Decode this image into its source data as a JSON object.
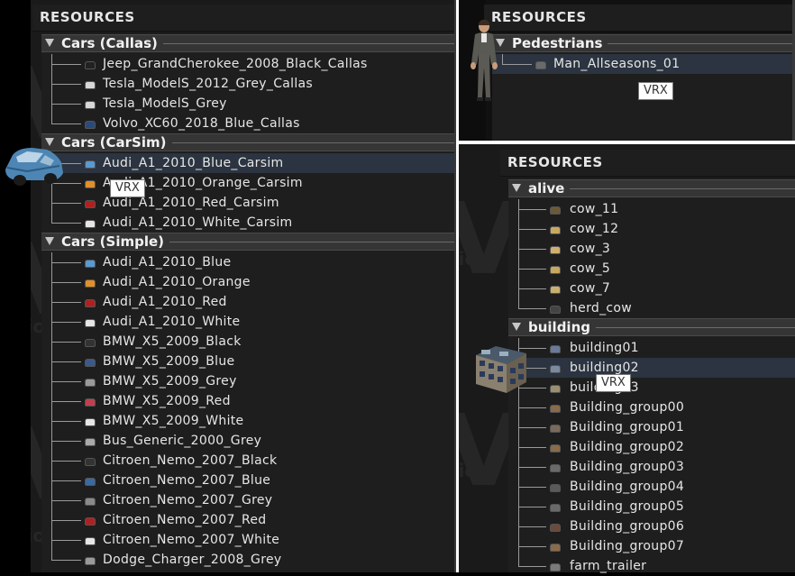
{
  "panel_left": {
    "title": "RESOURCES",
    "categories": [
      {
        "label": "Cars (Callas)",
        "items": [
          {
            "label": "Jeep_GrandCherokee_2008_Black_Callas",
            "color": "#222222"
          },
          {
            "label": "Tesla_ModelS_2012_Grey_Callas",
            "color": "#d8d8d8"
          },
          {
            "label": "Tesla_ModelS_Grey",
            "color": "#d8d8d8"
          },
          {
            "label": "Volvo_XC60_2018_Blue_Callas",
            "color": "#2a4a7a"
          }
        ]
      },
      {
        "label": "Cars (CarSim)",
        "items": [
          {
            "label": "Audi_A1_2010_Blue_Carsim",
            "color": "#5a9ad0",
            "selected": true
          },
          {
            "label": "Audi_A1_2010_Orange_Carsim",
            "color": "#e0902a"
          },
          {
            "label": "Audi_A1_2010_Red_Carsim",
            "color": "#b02020"
          },
          {
            "label": "Audi_A1_2010_White_Carsim",
            "color": "#e6e6e6"
          }
        ]
      },
      {
        "label": "Cars (Simple)",
        "items": [
          {
            "label": "Audi_A1_2010_Blue",
            "color": "#5a9ad0"
          },
          {
            "label": "Audi_A1_2010_Orange",
            "color": "#e0902a"
          },
          {
            "label": "Audi_A1_2010_Red",
            "color": "#b02020"
          },
          {
            "label": "Audi_A1_2010_White",
            "color": "#e6e6e6"
          },
          {
            "label": "BMW_X5_2009_Black",
            "color": "#333333"
          },
          {
            "label": "BMW_X5_2009_Blue",
            "color": "#3a5a8a"
          },
          {
            "label": "BMW_X5_2009_Grey",
            "color": "#9a9a9a"
          },
          {
            "label": "BMW_X5_2009_Red",
            "color": "#c04050"
          },
          {
            "label": "BMW_X5_2009_White",
            "color": "#e6e6e6"
          },
          {
            "label": "Bus_Generic_2000_Grey",
            "color": "#aaaaaa"
          },
          {
            "label": "Citroen_Nemo_2007_Black",
            "color": "#333333"
          },
          {
            "label": "Citroen_Nemo_2007_Blue",
            "color": "#3a6aa0"
          },
          {
            "label": "Citroen_Nemo_2007_Grey",
            "color": "#8a8a8a"
          },
          {
            "label": "Citroen_Nemo_2007_Red",
            "color": "#b02020"
          },
          {
            "label": "Citroen_Nemo_2007_White",
            "color": "#e6e6e6"
          },
          {
            "label": "Dodge_Charger_2008_Grey",
            "color": "#9a9a9a"
          }
        ]
      }
    ],
    "tooltip": "VRX"
  },
  "panel_top_right": {
    "title": "RESOURCES",
    "categories": [
      {
        "label": "Pedestrians",
        "items": [
          {
            "label": "Man_Allseasons_01",
            "color": "#6a6a6a",
            "selected": true
          }
        ]
      }
    ],
    "tooltip": "VRX"
  },
  "panel_bottom_right": {
    "title": "RESOURCES",
    "categories": [
      {
        "label": "alive",
        "items": [
          {
            "label": "cow_11",
            "color": "#6b5a3a"
          },
          {
            "label": "cow_12",
            "color": "#c8a860"
          },
          {
            "label": "cow_3",
            "color": "#d0b070"
          },
          {
            "label": "cow_5",
            "color": "#c8a860"
          },
          {
            "label": "cow_7",
            "color": "#c8b070"
          },
          {
            "label": "herd_cow",
            "color": "#444444"
          }
        ]
      },
      {
        "label": "building",
        "items": [
          {
            "label": "building01",
            "color": "#6a7a9a"
          },
          {
            "label": "building02",
            "color": "#7a8aa0",
            "selected": true
          },
          {
            "label": "building03",
            "color": "#9a9070"
          },
          {
            "label": "Building_group00",
            "color": "#8a6a4a"
          },
          {
            "label": "Building_group01",
            "color": "#7a6a5a"
          },
          {
            "label": "Building_group02",
            "color": "#8a6a4a"
          },
          {
            "label": "Building_group03",
            "color": "#6a6a6a"
          },
          {
            "label": "Building_group04",
            "color": "#5a5a5a"
          },
          {
            "label": "Building_group05",
            "color": "#6a6a6a"
          },
          {
            "label": "Building_group06",
            "color": "#6a4a3a"
          },
          {
            "label": "Building_group07",
            "color": "#8a6a4a"
          },
          {
            "label": "farm_trailer",
            "color": "#7a7a7a"
          }
        ]
      }
    ],
    "tooltip": "VRX"
  },
  "watermark": {
    "big": "Ve",
    "small": "tion"
  }
}
